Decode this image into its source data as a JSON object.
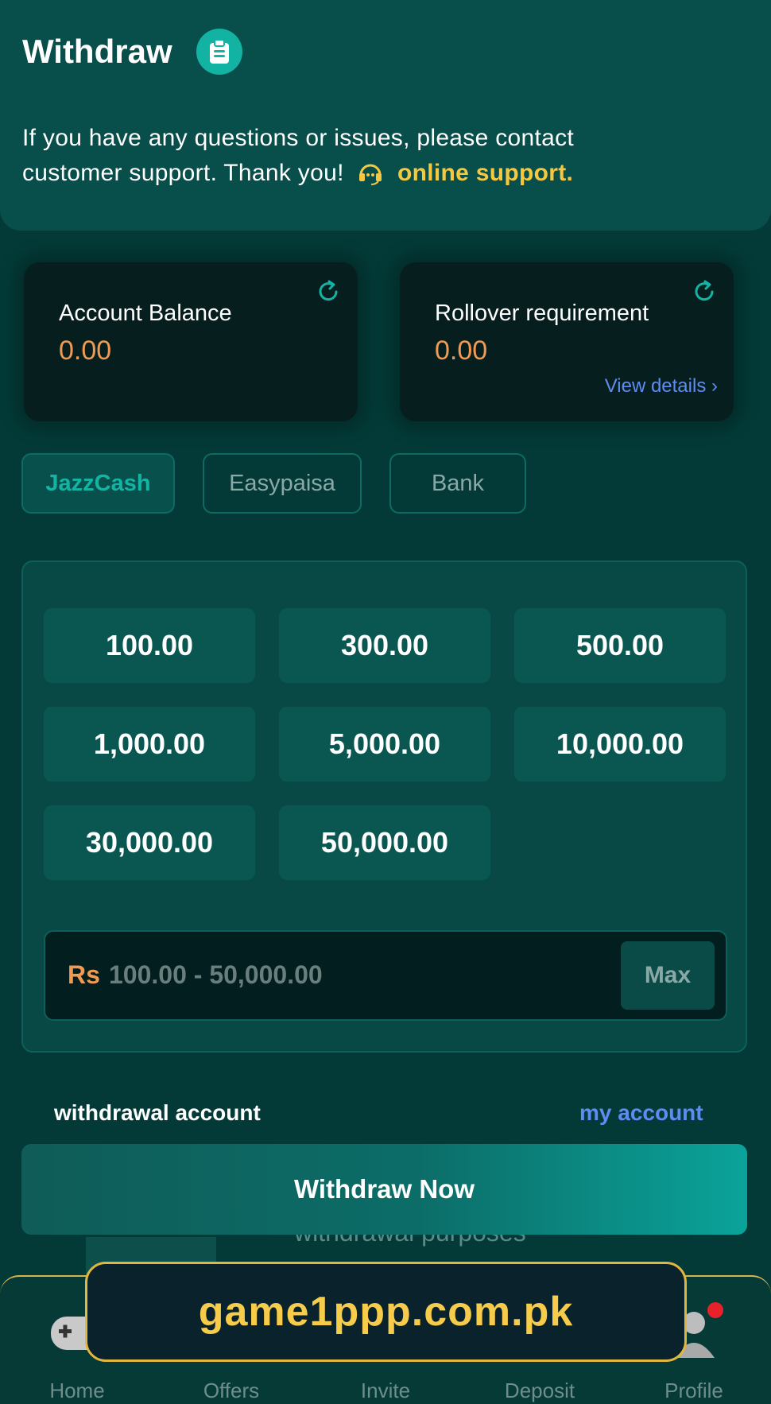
{
  "header": {
    "title": "Withdraw",
    "notice_text": "If you have any questions or issues, please contact customer support. Thank you!",
    "support_link": "online support."
  },
  "balance_card": {
    "label": "Account Balance",
    "value": "0.00"
  },
  "rollover_card": {
    "label": "Rollover requirement",
    "value": "0.00",
    "details_link": "View details"
  },
  "methods": [
    {
      "label": "JazzCash",
      "active": true
    },
    {
      "label": "Easypaisa",
      "active": false
    },
    {
      "label": "Bank",
      "active": false
    }
  ],
  "amounts": [
    "100.00",
    "300.00",
    "500.00",
    "1,000.00",
    "5,000.00",
    "10,000.00",
    "30,000.00",
    "50,000.00"
  ],
  "amount_input": {
    "currency": "Rs",
    "placeholder": "100.00 - 50,000.00",
    "max_label": "Max"
  },
  "withdrawal_account": {
    "label": "withdrawal account",
    "link": "my account"
  },
  "partial_text": "withdrawal purposes",
  "withdraw_button": "Withdraw Now",
  "nav": [
    {
      "label": "Home",
      "icon": "gamepad-icon"
    },
    {
      "label": "Offers",
      "icon": "gift-icon"
    },
    {
      "label": "Invite",
      "icon": "invite-icon"
    },
    {
      "label": "Deposit",
      "icon": "wallet-icon"
    },
    {
      "label": "Profile",
      "icon": "profile-icon"
    }
  ],
  "watermark": "game1ppp.com.pk",
  "colors": {
    "background": "#033a37",
    "header": "#084e4a",
    "accent": "#14b3a4",
    "balance": "#f29a52",
    "link": "#5f8cf0",
    "support": "#f5c842"
  }
}
